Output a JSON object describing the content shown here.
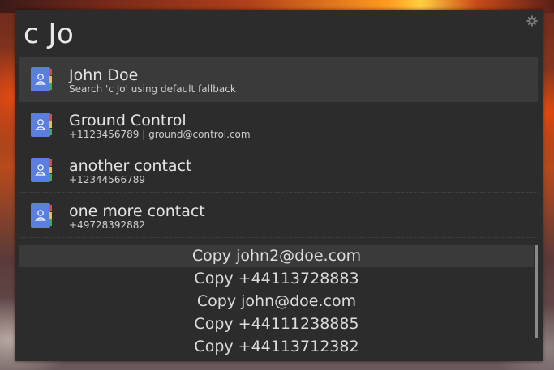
{
  "query": "c Jo",
  "results": [
    {
      "title": "John Doe",
      "subtitle": "Search 'c Jo' using default fallback",
      "selected": true
    },
    {
      "title": "Ground Control",
      "subtitle": "+1123456789 | ground@control.com",
      "selected": false
    },
    {
      "title": "another contact",
      "subtitle": "+12344566789",
      "selected": false
    },
    {
      "title": "one more contact",
      "subtitle": "+49728392882",
      "selected": false
    }
  ],
  "actions": [
    {
      "label": "Copy john2@doe.com",
      "selected": true
    },
    {
      "label": "Copy +44113728883",
      "selected": false
    },
    {
      "label": "Copy john@doe.com",
      "selected": false
    },
    {
      "label": "Copy +44111238885",
      "selected": false
    },
    {
      "label": "Copy +44113712382",
      "selected": false
    }
  ],
  "icons": {
    "result_icon": "contacts-book-icon",
    "settings_icon": "gear-icon"
  },
  "colors": {
    "panel_bg": "#2c2c2c",
    "selected_bg": "#3a3a3a",
    "text": "#e4e4e4",
    "icon_blue": "#5a7fe0"
  }
}
